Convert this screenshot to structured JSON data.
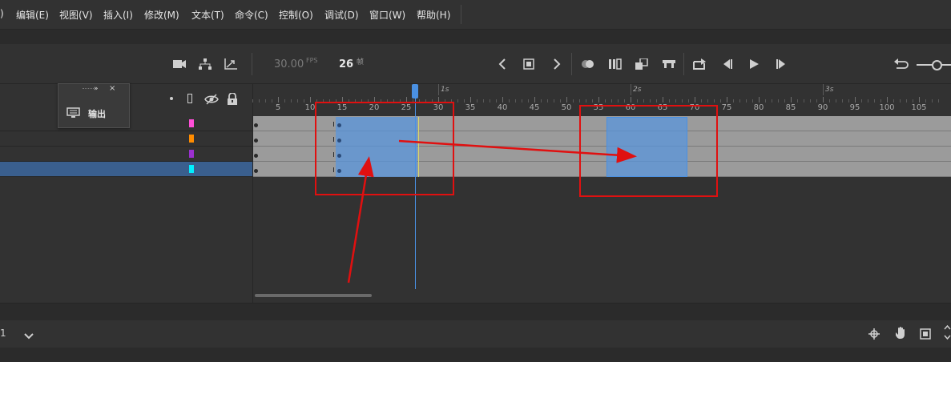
{
  "menu": {
    "items": [
      ")",
      "编辑(E)",
      "视图(V)",
      "插入(I)",
      "修改(M)",
      "文本(T)",
      "命令(C)",
      "控制(O)",
      "调试(D)",
      "窗口(W)",
      "帮助(H)"
    ]
  },
  "toolbar": {
    "fps_value": "30.00",
    "fps_unit": "FPS",
    "current_frame": "26",
    "frame_unit": "帧",
    "icons": [
      "camera-icon",
      "hierarchy-icon",
      "graph-icon",
      "prev-keyframe-icon",
      "keyframe-icon",
      "next-keyframe-icon",
      "onion-skin-icon",
      "onion-outline-icon",
      "edit-multiple-frames-icon",
      "center-frame-icon",
      "loop-icon",
      "step-back-icon",
      "play-icon",
      "step-forward-icon",
      "undo-icon"
    ]
  },
  "output_popup": {
    "label": "输出"
  },
  "layers": {
    "colors": [
      "#ff4fd8",
      "#ff8c00",
      "#9b30d0",
      "#00f0ff"
    ],
    "selected_index": 3,
    "selected_color": "#3a5f8e"
  },
  "ruler": {
    "ticks": [
      "5",
      "10",
      "15",
      "20",
      "25",
      "30",
      "35",
      "40",
      "45",
      "50",
      "55",
      "60",
      "65",
      "70",
      "75",
      "80",
      "85",
      "90",
      "95",
      "100",
      "105"
    ],
    "seconds": [
      "1s",
      "2s",
      "3s"
    ]
  },
  "bottom": {
    "left_text": "1"
  },
  "colors": {
    "panel": "#323232",
    "track": "#9b9b9b",
    "selection": "#5a96dc",
    "playhead": "#4a90e2",
    "annotation": "#e01010"
  }
}
